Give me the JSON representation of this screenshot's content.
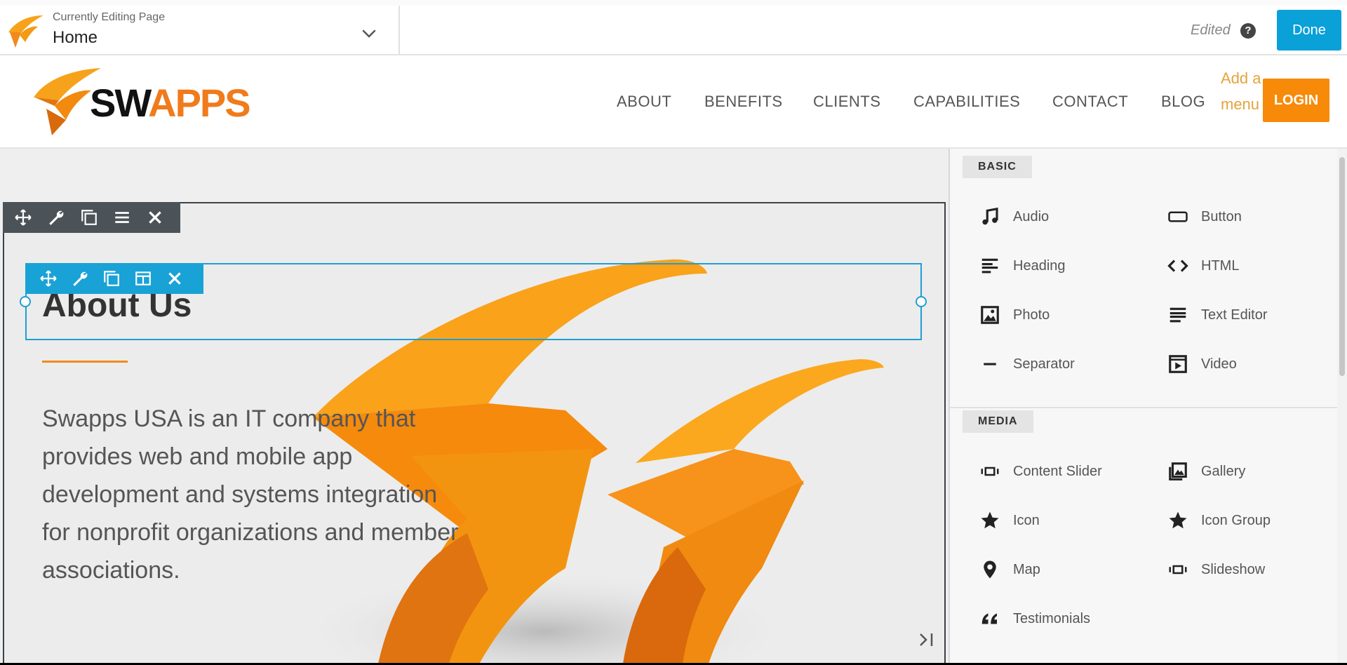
{
  "topbar": {
    "editing_label": "Currently Editing Page",
    "page_name": "Home",
    "status": "Edited",
    "help_glyph": "?",
    "done_label": "Done"
  },
  "site": {
    "brand_prefix": "SWAPPS",
    "nav": [
      "ABOUT",
      "BENEFITS",
      "CLIENTS",
      "CAPABILITIES",
      "CONTACT",
      "BLOG"
    ],
    "add_menu": "Add a menu",
    "login_label": "LOGIN"
  },
  "content": {
    "heading": "About Us",
    "paragraph": "Swapps USA is an IT company that provides web and mobile app development and systems integration for nonprofit organizations and member associations."
  },
  "panel": {
    "basic": {
      "title": "BASIC",
      "items": [
        {
          "label": "Audio",
          "icon": "music-note-icon"
        },
        {
          "label": "Button",
          "icon": "button-icon"
        },
        {
          "label": "Heading",
          "icon": "heading-icon"
        },
        {
          "label": "HTML",
          "icon": "code-icon"
        },
        {
          "label": "Photo",
          "icon": "photo-icon"
        },
        {
          "label": "Text Editor",
          "icon": "text-editor-icon"
        },
        {
          "label": "Separator",
          "icon": "separator-icon"
        },
        {
          "label": "Video",
          "icon": "video-icon"
        }
      ]
    },
    "media": {
      "title": "MEDIA",
      "items": [
        {
          "label": "Content Slider",
          "icon": "slider-icon"
        },
        {
          "label": "Gallery",
          "icon": "gallery-icon"
        },
        {
          "label": "Icon",
          "icon": "star-icon"
        },
        {
          "label": "Icon Group",
          "icon": "star-icon"
        },
        {
          "label": "Map",
          "icon": "map-pin-icon"
        },
        {
          "label": "Slideshow",
          "icon": "slideshow-icon"
        },
        {
          "label": "Testimonials",
          "icon": "quote-icon"
        }
      ]
    }
  },
  "colors": {
    "accent_blue": "#19a2d6",
    "brand_orange": "#f78a08",
    "row_toolbar": "#4b5359"
  }
}
